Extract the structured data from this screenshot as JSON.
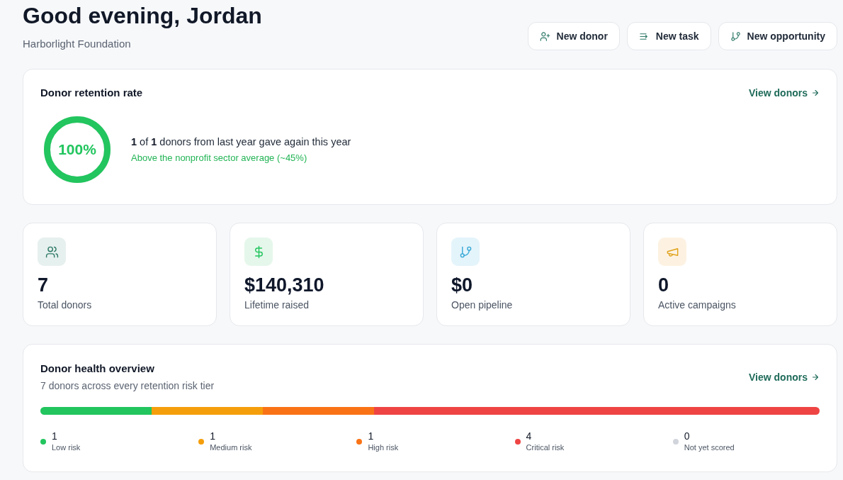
{
  "header": {
    "title": "Good evening, Jordan",
    "subtitle": "Harborlight Foundation"
  },
  "actions": [
    "New donor",
    "New task",
    "New opportunity"
  ],
  "retention": {
    "title": "Donor retention rate",
    "link": "View donors",
    "ring_label": "100%",
    "level": 1,
    "summary": "**1** of **1** donors from last year gave again this year",
    "note": "Above the nonprofit sector average (~45%)"
  },
  "stats": [
    {
      "value": "7",
      "label": "Total donors"
    },
    {
      "value": "$140,310",
      "label": "Lifetime raised"
    },
    {
      "value": "$0",
      "label": "Open pipeline"
    },
    {
      "value": "0",
      "label": "Active campaigns"
    }
  ],
  "health": {
    "title": "Donor health overview",
    "subtitle": "7 donors across every retention risk tier",
    "link": "View donors",
    "tiers": [
      {
        "count": "1",
        "label": "Low risk",
        "color": "#22c55e"
      },
      {
        "count": "1",
        "label": "Medium risk",
        "color": "#f59e0b"
      },
      {
        "count": "1",
        "label": "High risk",
        "color": "#f97316"
      },
      {
        "count": "4",
        "label": "Critical risk",
        "color": "#ef4444"
      },
      {
        "count": "0",
        "label": "Not yet scored",
        "color": "#d1d5db"
      }
    ]
  }
}
